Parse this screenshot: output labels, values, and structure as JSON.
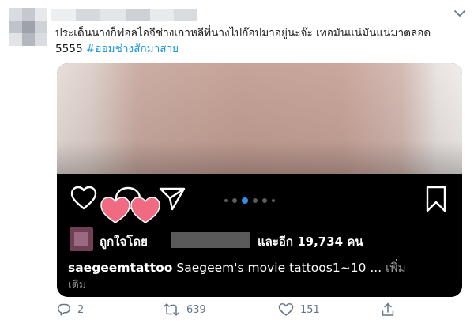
{
  "tweet": {
    "text_line1": "ประเด็นนางก็ฟอลไอจีช่างเกาหลีที่นางไปก๊อปมาอยู่นะจ๊ะ เทอมันแน่มันแน่มาตลอด",
    "text_line2": "5555 ",
    "hashtag": "#ออมช่างสักมาสาย",
    "colors": {
      "text": "#14171a",
      "hashtag": "#1b95e0",
      "muted": "#657786"
    }
  },
  "instagram_embed": {
    "liked_by_prefix": "ถูกใจโดย",
    "liked_by_suffix": "และอีก 19,734 คน",
    "caption_user": "saegeemtattoo",
    "caption_text": " Saegeem's movie tattoos1~10 ... ",
    "caption_more": "เพิ่ม",
    "caption_more_line2": "เติม",
    "carousel_active_index": 2,
    "carousel_count": 5
  },
  "actions": {
    "reply_count": "2",
    "retweet_count": "639",
    "like_count": "151"
  },
  "icons": [
    "chevron-down-icon",
    "heart-outline-icon",
    "comment-icon",
    "share-icon",
    "bookmark-icon",
    "heart-sticker-icon",
    "reply-icon",
    "retweet-icon",
    "like-icon",
    "share-up-icon"
  ]
}
